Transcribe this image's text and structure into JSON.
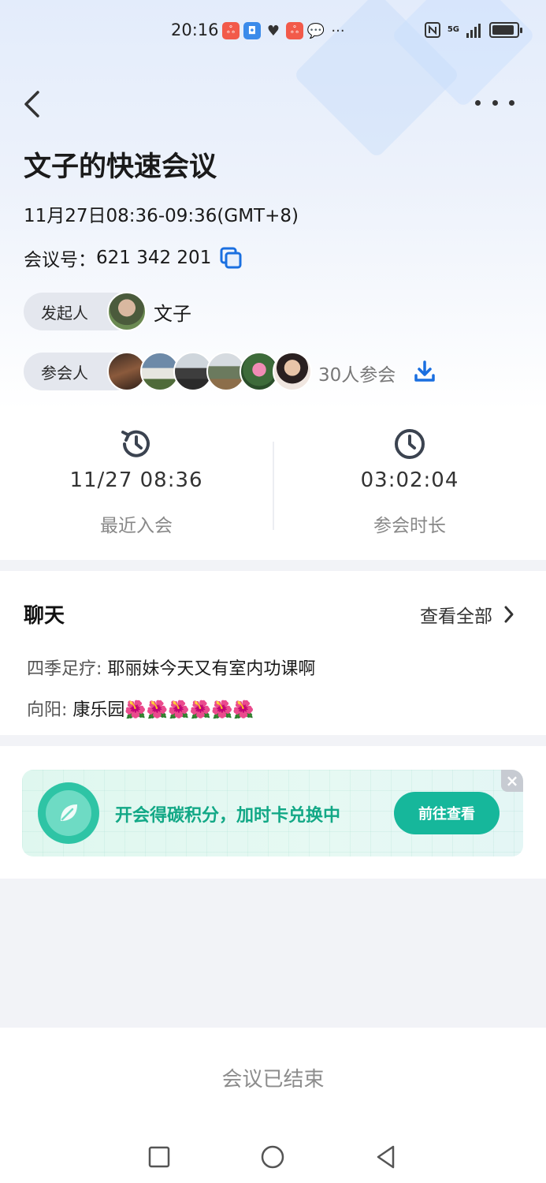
{
  "status_bar": {
    "time": "20:16",
    "network": "5G"
  },
  "header": {
    "title": "文子的快速会议"
  },
  "meeting": {
    "time_range": "11月27日08:36-09:36(GMT+8)",
    "id_label": "会议号：",
    "id_value": "621 342 201"
  },
  "host": {
    "label": "发起人",
    "name": "文子"
  },
  "participants": {
    "label": "参会人",
    "count_text": "30人参会"
  },
  "stats": {
    "last_join": {
      "value": "11/27 08:36",
      "label": "最近入会"
    },
    "duration": {
      "value": "03:02:04",
      "label": "参会时长"
    }
  },
  "chat": {
    "title": "聊天",
    "view_all": "查看全部",
    "messages": [
      {
        "sender": "四季足疗: ",
        "text": "耶丽妹今天又有室内功课啊"
      },
      {
        "sender": "向阳: ",
        "text": "康乐园🌺🌺🌺🌺🌺🌺"
      }
    ]
  },
  "banner": {
    "text": "开会得碳积分，加时卡兑换中",
    "button": "前往查看",
    "close": "×"
  },
  "footer": {
    "status": "会议已结束"
  },
  "colors": {
    "accent_blue": "#1a6fe0",
    "banner_green": "#16b79b",
    "banner_text": "#12a886"
  }
}
